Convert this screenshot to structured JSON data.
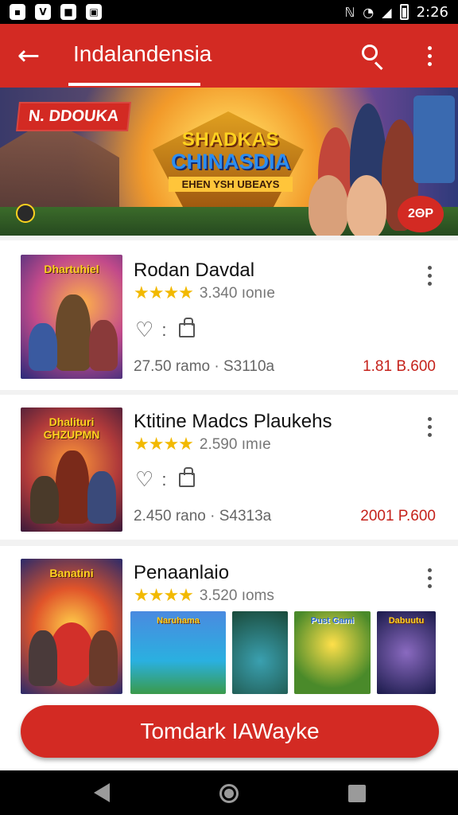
{
  "status_bar": {
    "left_icons": [
      "notification-icon-1",
      "notification-icon-2",
      "notification-icon-3",
      "notification-icon-4"
    ],
    "left_glyphs": [
      "▪",
      "V",
      "■",
      "▣"
    ],
    "time": "2:26"
  },
  "app_bar": {
    "title": "Indalandensia",
    "back_icon": "arrow-left-icon",
    "search_icon": "search-icon",
    "more_icon": "more-vert-icon"
  },
  "banner": {
    "tag": "N. DDOUKA",
    "title_line1": "SHADKAS",
    "title_line2": "CHINASDIA",
    "subtitle": "EHEN YSH UBEAYS",
    "badge": "2ΘP"
  },
  "games": [
    {
      "title": "Rodan Davdal",
      "thumb_title": "Dhartuhiel",
      "stars": "★★★★",
      "rating_text": "3.340 ıonıe",
      "meta": "27.50 ramo · S3110a",
      "price": "1.81 B.600"
    },
    {
      "title": "Ktitine Madcs Plaukehs",
      "thumb_title": "Dhalituri GHZUPMN",
      "stars": "★★★★",
      "rating_text": "2.590 ımıe",
      "meta": "2.450 rano · S4313a",
      "price": "2001 P.600"
    },
    {
      "title": "Penaanlaio",
      "thumb_title": "Banatini",
      "stars": "★★★★",
      "rating_text": "3.520 ıoms",
      "screenshots": [
        "Naruhama",
        "",
        "Pust Gami",
        "Dabuutu"
      ]
    }
  ],
  "cta": {
    "label": "Tomdark IAWayke"
  },
  "colors": {
    "accent": "#d32a23",
    "star": "#f2b900",
    "price": "#c5221b"
  }
}
